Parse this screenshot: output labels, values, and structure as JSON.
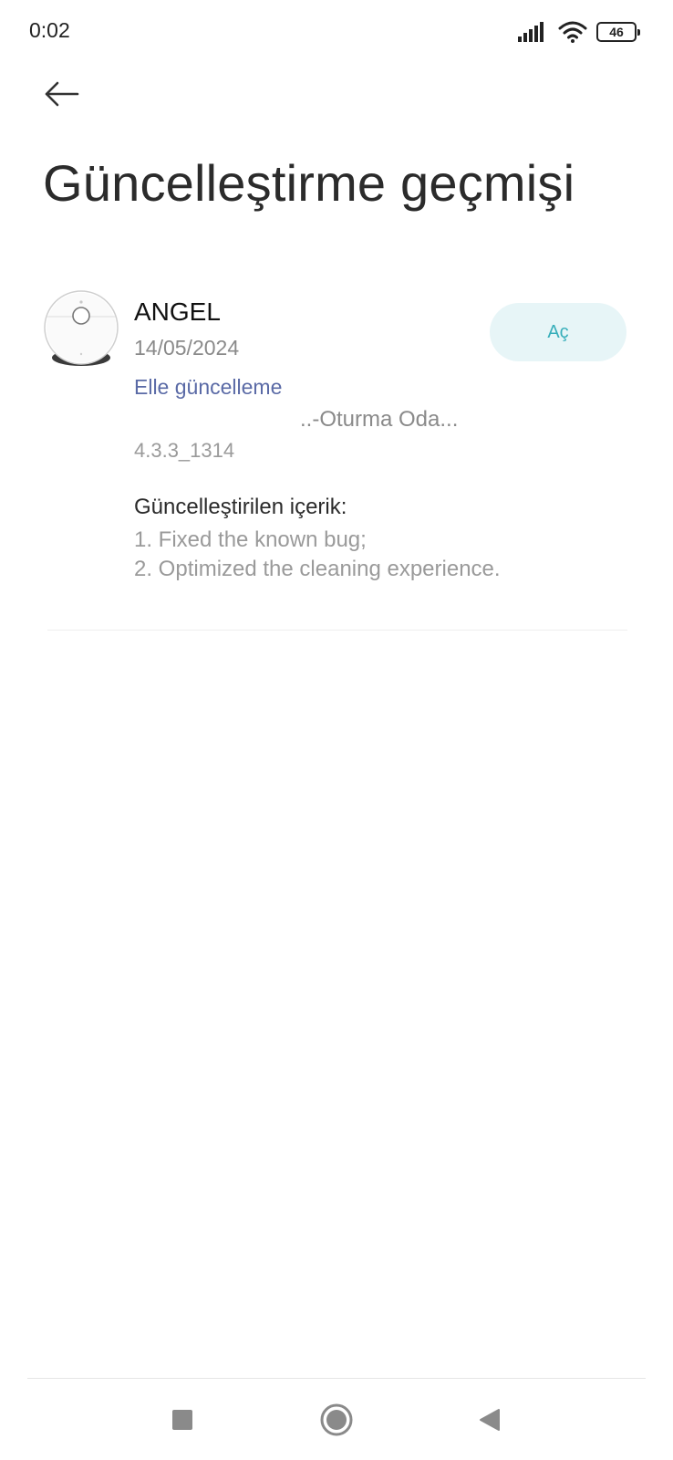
{
  "status_bar": {
    "time": "0:02",
    "battery_level": "46",
    "signal_icon": "signal-bars-icon",
    "wifi_icon": "wifi-icon"
  },
  "header": {
    "back_icon": "arrow-left-icon",
    "title": "Güncelleştirme geçmişi"
  },
  "entry": {
    "device_image": "robot-vacuum-image",
    "device_name": "ANGEL",
    "date": "14/05/2024",
    "update_type": "Elle güncelleme",
    "room": "..-Oturma Oda...",
    "version": "4.3.3_1314",
    "open_button_label": "Aç",
    "content_heading": "Güncelleştirilen içerik:",
    "content_lines": [
      "1. Fixed the known bug;",
      "2. Optimized the cleaning experience."
    ]
  },
  "nav_bar": {
    "recents_icon": "square-icon",
    "home_icon": "circle-icon",
    "back_icon": "triangle-back-icon"
  },
  "colors": {
    "accent_button_bg": "#e7f5f7",
    "accent_button_text": "#37aeba",
    "update_type_text": "#5a6aa6"
  }
}
